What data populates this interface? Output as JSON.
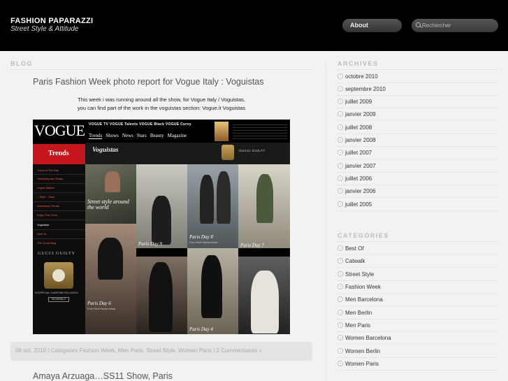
{
  "header": {
    "site_title": "FASHION PAPARAZZI",
    "tagline": "Street Style & Attitude",
    "nav_about": "About",
    "search_placeholder": "Rechercher"
  },
  "main": {
    "section_heading": "BLOG",
    "post1": {
      "title": "Paris Fashion Week photo report for Vogue Italy : Voguistas",
      "intro_line1": "This week i was running around all the show, for Vogue Italy / Voguistas,",
      "intro_line2": "you can find part of the work in the voguistas section: Vogue.it Voguistas",
      "meta": "06 oct. 2010 | Categories Fashion Week, Men Paris, Street Style, Women Paris | 2 Commentaires »"
    },
    "post2": {
      "title": "Amaya Arzuaga…SS11 Show, Paris"
    }
  },
  "vogue_image": {
    "logo": "VOGUE",
    "top_links": "VOGUE TV   VOGUE Talents   VOGUE Black   VOGUE Curvy",
    "menu": [
      "Trends",
      "Shows",
      "News",
      "Stars",
      "Beauty",
      "Magazine"
    ],
    "trends_label": "Trends",
    "banner_title": "Voguistas",
    "gucci_banner": "GUCCI GUILTY",
    "side_items": [
      "Trend of The Day",
      "Yesterday and Today",
      "Vogue Market",
      "+ Style - Cash",
      "Accessory Trends",
      "Enjoy The Trend",
      "Voguistas",
      "How To",
      "The Trend Blog"
    ],
    "side_gucci": "GUCCI GUILTY",
    "side_caption": "SCOPRI DAL CAMPIONE ESCLUSIVO",
    "side_button": "RICHIEDILO",
    "street_caption": "Street style around the world",
    "captions": [
      "Paris Day 9",
      "Paris Day 8",
      "Paris Day 7",
      "Paris Day 6",
      "Paris Day 4"
    ],
    "caption_sub": "From Paris Fashion Week"
  },
  "sidebar": {
    "archives_heading": "ARCHIVES",
    "archives": [
      "octobre 2010",
      "septembre 2010",
      "juillet 2009",
      "janvier 2009",
      "juillet 2008",
      "janvier 2008",
      "juillet 2007",
      "janvier 2007",
      "juillet 2006",
      "janvier 2006",
      "juillet 2005"
    ],
    "categories_heading": "CATEGORIES",
    "categories": [
      "Best Of",
      "Catwalk",
      "Street Style",
      "Fashion Week",
      "Men Barcelona",
      "Men Berlin",
      "Men Paris",
      "Women Barcelona",
      "Women Berlin",
      "Women Paris"
    ]
  }
}
